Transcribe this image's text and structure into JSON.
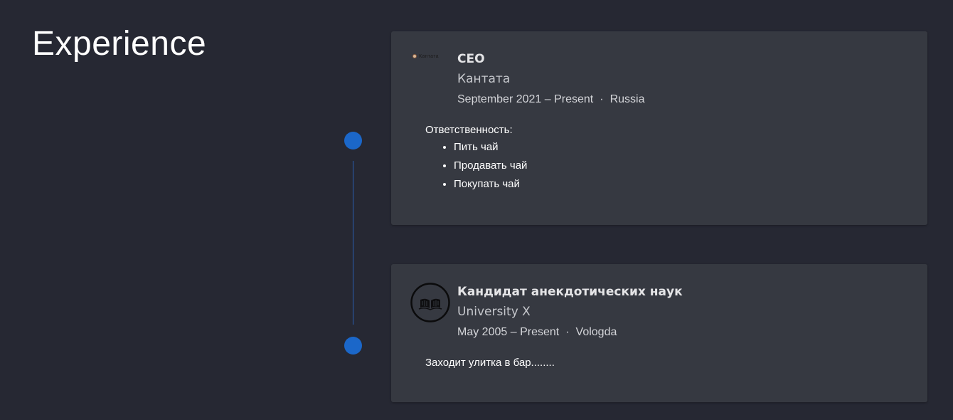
{
  "section": {
    "title": "Experience"
  },
  "colors": {
    "background": "#262833",
    "card": "#363941",
    "accent": "#1b67c9"
  },
  "experience": [
    {
      "logo_text": "Кантата",
      "role": "CEO",
      "organization": "Кантата",
      "start": "September 2021",
      "end": "Present",
      "location": "Russia",
      "description_label": "Ответственность:",
      "bullets": [
        "Пить чай",
        "Продавать чай",
        "Покупать чай"
      ]
    },
    {
      "logo_icon": "open-book-icon",
      "role": "Кандидат анекдотических наук",
      "organization": "University X",
      "start": "May 2005",
      "end": "Present",
      "location": "Vologda",
      "description": "Заходит улитка в бар........"
    }
  ]
}
